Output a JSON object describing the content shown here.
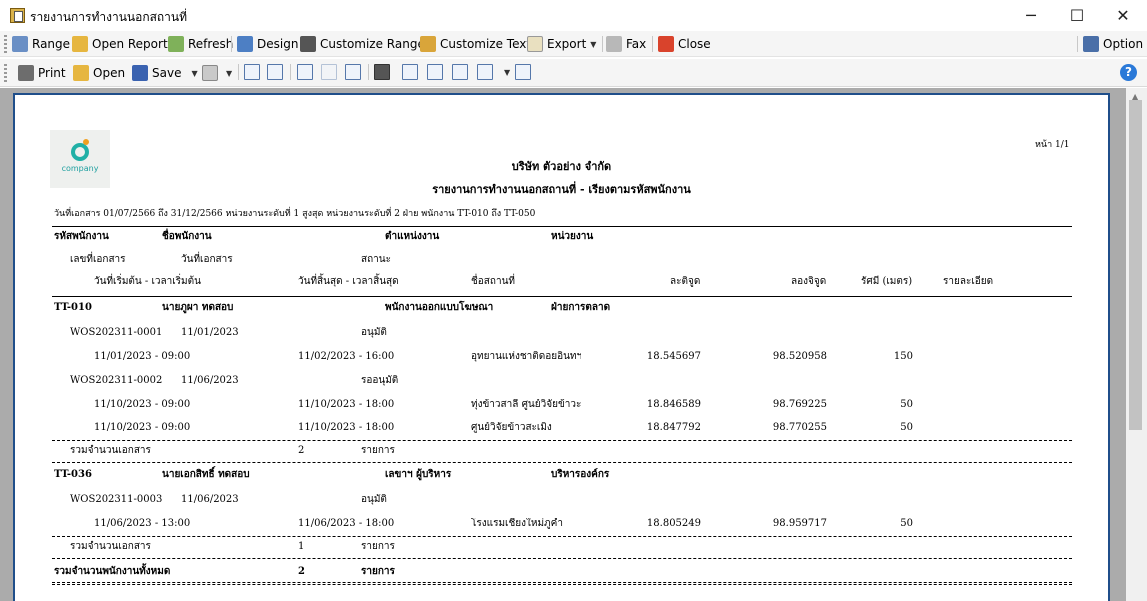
{
  "window": {
    "title": "รายงานการทำงานนอกสถานที่",
    "minimize": "─",
    "maximize": "☐",
    "close": "✕"
  },
  "toolbar1": {
    "range": "Range",
    "open_report": "Open Report",
    "refresh": "Refresh",
    "design": "Design",
    "customize_range": "Customize Range",
    "customize_text": "Customize Text",
    "export": "Export",
    "fax": "Fax",
    "close": "Close",
    "option": "Option"
  },
  "toolbar2": {
    "print": "Print",
    "open": "Open",
    "save": "Save",
    "help": "?"
  },
  "report": {
    "page_no": "หน้า 1/1",
    "logo_text": "company",
    "company": "บริษัท ตัวอย่าง จำกัด",
    "title": "รายงานการทำงานนอกสถานที่ - เรียงตามรหัสพนักงาน",
    "criteria": "วันที่เอกสาร 01/07/2566 ถึง 31/12/2566 หน่วยงานระดับที่ 1 สูงสุด หน่วยงานระดับที่ 2 ฝ่าย พนักงาน TT-010 ถึง TT-050",
    "headers": {
      "emp_code": "รหัสพนักงาน",
      "emp_name": "ชื่อพนักงาน",
      "position": "ตำแหน่งงาน",
      "department": "หน่วยงาน",
      "doc_no": "เลขที่เอกสาร",
      "doc_date": "วันที่เอกสาร",
      "status": "สถานะ",
      "start": "วันที่เริ่มต้น - เวลาเริ่มต้น",
      "end": "วันที่สิ้นสุด - เวลาสิ้นสุด",
      "place": "ชื่อสถานที่",
      "lat": "ละติจูด",
      "lon": "ลองจิจูด",
      "radius": "รัศมี (เมตร)",
      "detail": "รายละเอียด"
    },
    "groups": [
      {
        "emp_code": "TT-010",
        "emp_name": "นายภูผา ทดสอบ",
        "position": "พนักงานออกแบบโฆษณา",
        "department": "ฝ่ายการตลาด",
        "docs": [
          {
            "doc_no": "WOS202311-0001",
            "doc_date": "11/01/2023",
            "status": "อนุมัติ",
            "lines": [
              {
                "start": "11/01/2023 - 09:00",
                "end": "11/02/2023 - 16:00",
                "place": "อุทยานแห่งชาติดอยอินทฯ",
                "lat": "18.545697",
                "lon": "98.520958",
                "radius": "150"
              }
            ]
          },
          {
            "doc_no": "WOS202311-0002",
            "doc_date": "11/06/2023",
            "status": "รออนุมัติ",
            "lines": [
              {
                "start": "11/10/2023 - 09:00",
                "end": "11/10/2023 - 18:00",
                "place": "ทุ่งข้าวสาลี ศูนย์วิจัยข้าวะ",
                "lat": "18.846589",
                "lon": "98.769225",
                "radius": "50"
              },
              {
                "start": "11/10/2023 - 09:00",
                "end": "11/10/2023 - 18:00",
                "place": "ศูนย์วิจัยข้าวสะเมิง",
                "lat": "18.847792",
                "lon": "98.770255",
                "radius": "50"
              }
            ]
          }
        ],
        "total_label": "รวมจำนวนเอกสาร",
        "total_count": "2",
        "total_unit": "รายการ"
      },
      {
        "emp_code": "TT-036",
        "emp_name": "นายเอกสิทธิ์ ทดสอบ",
        "position": "เลขาฯ ผู้บริหาร",
        "department": "บริหารองค์กร",
        "docs": [
          {
            "doc_no": "WOS202311-0003",
            "doc_date": "11/06/2023",
            "status": "อนุมัติ",
            "lines": [
              {
                "start": "11/06/2023 - 13:00",
                "end": "11/06/2023 - 18:00",
                "place": "โรงแรมเชียงใหม่ภูคำ",
                "lat": "18.805249",
                "lon": "98.959717",
                "radius": "50"
              }
            ]
          }
        ],
        "total_label": "รวมจำนวนเอกสาร",
        "total_count": "1",
        "total_unit": "รายการ"
      }
    ],
    "grand_total_label": "รวมจำนวนพนักงานทั้งหมด",
    "grand_total_count": "2",
    "grand_total_unit": "รายการ"
  }
}
